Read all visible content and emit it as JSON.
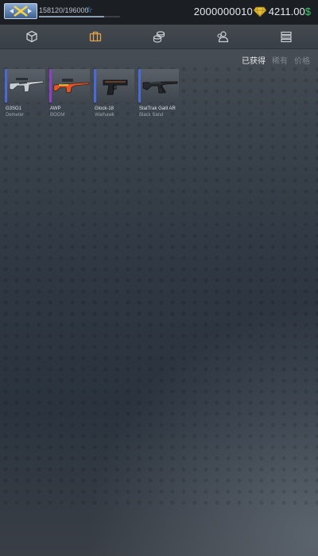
{
  "header": {
    "xp_text": "158120/196000",
    "xp_progress": 0.807,
    "gold": "2000000010",
    "cash": "4211.00",
    "cash_sign": "$",
    "colors": {
      "cash_sign": "#33d06b",
      "xp_star": "#5fa7ff",
      "gem": "#e8c23a"
    }
  },
  "nav": {
    "tabs": [
      {
        "icon": "case-icon"
      },
      {
        "icon": "inventory-icon",
        "active": true
      },
      {
        "icon": "coins-icon"
      },
      {
        "icon": "profile-icon"
      },
      {
        "icon": "menu-icon"
      }
    ],
    "active_color": "#e3a34d"
  },
  "sort": {
    "options": [
      "已获得",
      "稀有",
      "价格"
    ],
    "active_index": 0
  },
  "items": [
    {
      "name": "G3SG1",
      "skin": "Demeter",
      "rarity_color": "#4b6ad8"
    },
    {
      "name": "AWP",
      "skin": "BOOM",
      "rarity_color": "#8f3fc8"
    },
    {
      "name": "Glock-18",
      "skin": "Warhawk",
      "rarity_color": "#4b6ad8"
    },
    {
      "name": "StatTrak Galil AR",
      "skin": "Black Sand",
      "rarity_color": "#4b6ad8"
    }
  ]
}
